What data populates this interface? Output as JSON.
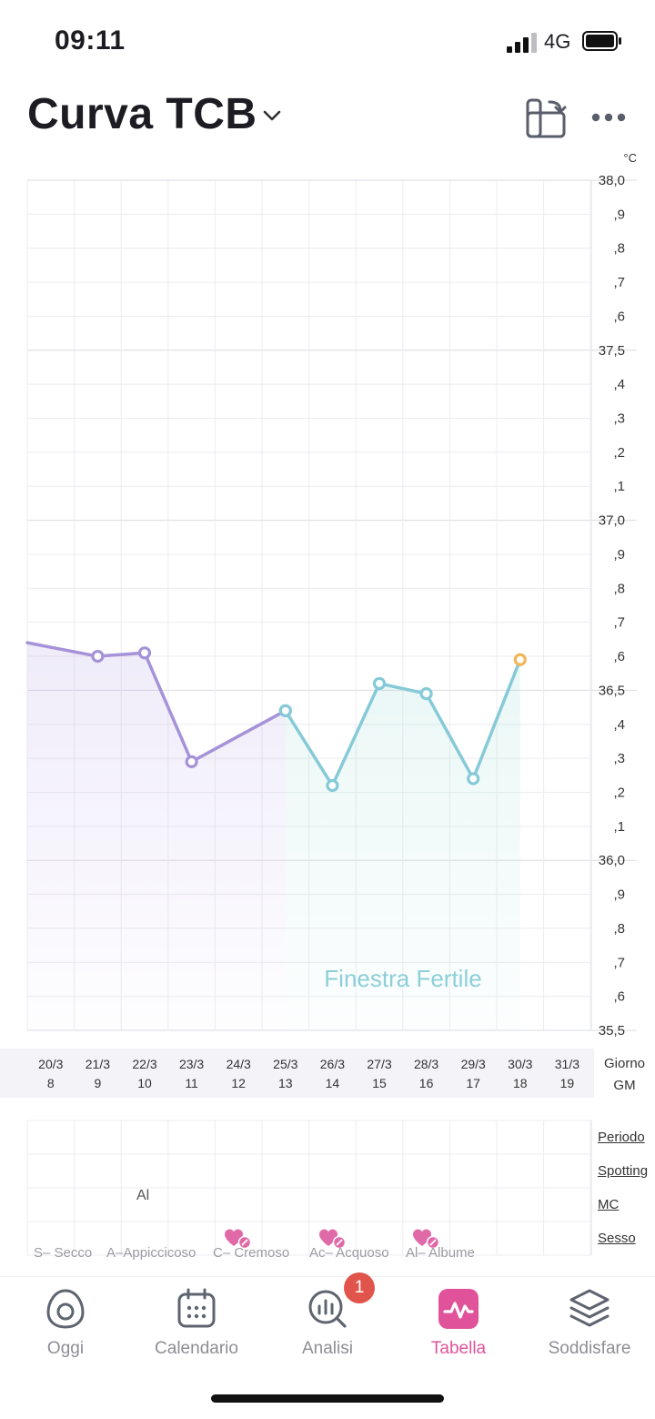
{
  "status": {
    "time": "09:11",
    "network": "4G"
  },
  "header": {
    "title": "Curva TCB"
  },
  "chart_data": {
    "type": "line",
    "unit": "°C",
    "ylim": [
      35.5,
      38.0
    ],
    "y_tick_labels": [
      "38,0",
      ",9",
      ",8",
      ",7",
      ",6",
      "37,5",
      ",4",
      ",3",
      ",2",
      ",1",
      "37,0",
      ",9",
      ",8",
      ",7",
      ",6",
      "36,5",
      ",4",
      ",3",
      ",2",
      ",1",
      "36,0",
      ",9",
      ",8",
      ",7",
      ",6",
      "35,5"
    ],
    "categories": [
      "20/3",
      "21/3",
      "22/3",
      "23/3",
      "24/3",
      "25/3",
      "26/3",
      "27/3",
      "28/3",
      "29/3",
      "30/3",
      "31/3"
    ],
    "cycle_days": [
      "8",
      "9",
      "10",
      "11",
      "12",
      "13",
      "14",
      "15",
      "16",
      "17",
      "18",
      "19"
    ],
    "series": [
      {
        "segment": "pre-fertile",
        "color": "#a592d9",
        "points": [
          [
            19.5,
            36.64
          ],
          [
            21,
            36.6
          ],
          [
            22,
            36.61
          ],
          [
            23,
            36.29
          ],
          [
            25,
            36.44
          ]
        ]
      },
      {
        "segment": "fertile",
        "color": "#86cad8",
        "points": [
          [
            25,
            36.44
          ],
          [
            26,
            36.22
          ],
          [
            27,
            36.52
          ],
          [
            28,
            36.49
          ],
          [
            29,
            36.24
          ],
          [
            30,
            36.59
          ]
        ]
      }
    ],
    "latest_point": {
      "x": 30,
      "y": 36.59,
      "color": "#f0b65a"
    },
    "fertile_window": {
      "label": "Finestra Fertile",
      "from": "25/3",
      "to": "30/3",
      "color": "#8ccfd8"
    },
    "grid": true
  },
  "axis_labels": {
    "giorno": "Giorno",
    "gm": "GM"
  },
  "observations": {
    "rows": [
      "Periodo",
      "Spotting",
      "MC",
      "Sesso"
    ],
    "mc_value": "Al",
    "sex_icon": "heart-check-icon",
    "legend": [
      "S– Secco",
      "A–Appiccicoso",
      "C– Cremoso",
      "Ac– Acquoso",
      "Al– Albume"
    ]
  },
  "tabbar": {
    "tabs": [
      {
        "label": "Oggi",
        "icon": "egg-icon"
      },
      {
        "label": "Calendario",
        "icon": "calendar-icon"
      },
      {
        "label": "Analisi",
        "icon": "analysis-icon",
        "badge": "1"
      },
      {
        "label": "Tabella",
        "icon": "chart-pulse-icon",
        "active": true
      },
      {
        "label": "Soddisfare",
        "icon": "layers-icon"
      }
    ]
  },
  "colors": {
    "accent": "#e0539a",
    "pre_fertile": "#a592d9",
    "fertile": "#86cad8",
    "latest": "#f0b65a"
  }
}
